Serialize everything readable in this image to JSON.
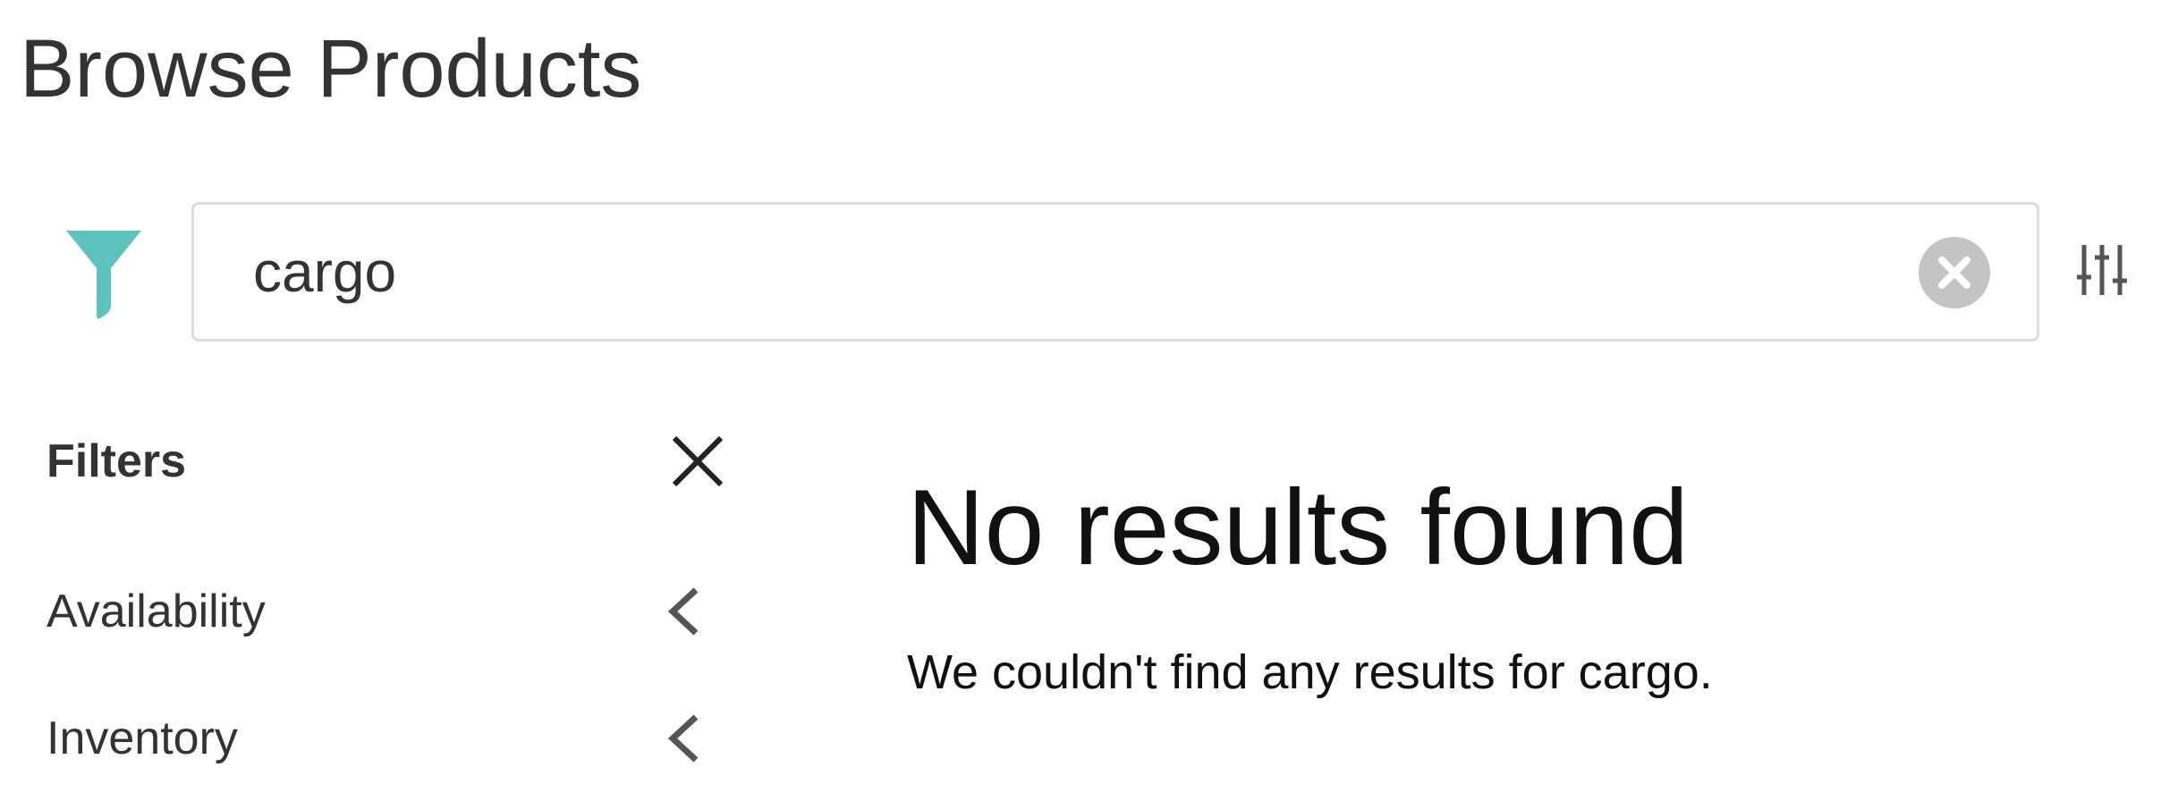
{
  "page": {
    "title": "Browse Products"
  },
  "search": {
    "value": "cargo",
    "accent_color": "#5cc3be"
  },
  "filters": {
    "title": "Filters",
    "groups": [
      {
        "label": "Availability"
      },
      {
        "label": "Inventory"
      }
    ]
  },
  "results": {
    "empty_title": "No results found",
    "empty_message": "We couldn't find any results for cargo."
  },
  "icons": {
    "filter": "filter-funnel-icon",
    "clear": "clear-circle-x-icon",
    "settings": "sliders-icon",
    "close": "close-icon",
    "chevron": "chevron-left-icon"
  }
}
